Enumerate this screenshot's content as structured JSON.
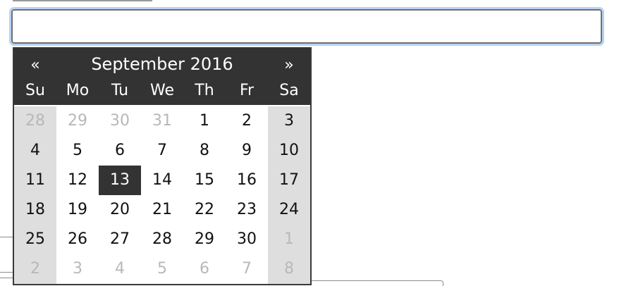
{
  "date_input": {
    "value": "",
    "placeholder": ""
  },
  "datepicker": {
    "prev_label": "«",
    "next_label": "»",
    "month_title": "September 2016",
    "weekdays": [
      "Su",
      "Mo",
      "Tu",
      "We",
      "Th",
      "Fr",
      "Sa"
    ],
    "selected_day": "13",
    "weeks": [
      [
        "28",
        "29",
        "30",
        "31",
        "1",
        "2",
        "3"
      ],
      [
        "4",
        "5",
        "6",
        "7",
        "8",
        "9",
        "10"
      ],
      [
        "11",
        "12",
        "13",
        "14",
        "15",
        "16",
        "17"
      ],
      [
        "18",
        "19",
        "20",
        "21",
        "22",
        "23",
        "24"
      ],
      [
        "25",
        "26",
        "27",
        "28",
        "29",
        "30",
        "1"
      ],
      [
        "2",
        "3",
        "4",
        "5",
        "6",
        "7",
        "8"
      ]
    ],
    "muted": [
      [
        true,
        true,
        true,
        true,
        false,
        false,
        false
      ],
      [
        false,
        false,
        false,
        false,
        false,
        false,
        false
      ],
      [
        false,
        false,
        false,
        false,
        false,
        false,
        false
      ],
      [
        false,
        false,
        false,
        false,
        false,
        false,
        false
      ],
      [
        false,
        false,
        false,
        false,
        false,
        false,
        true
      ],
      [
        true,
        true,
        true,
        true,
        true,
        true,
        true
      ]
    ]
  },
  "colors": {
    "header_bg": "#333333",
    "weekend_bg": "#dedede",
    "muted_text": "#b8b8b8",
    "focus_ring": "#b7d3f3"
  }
}
